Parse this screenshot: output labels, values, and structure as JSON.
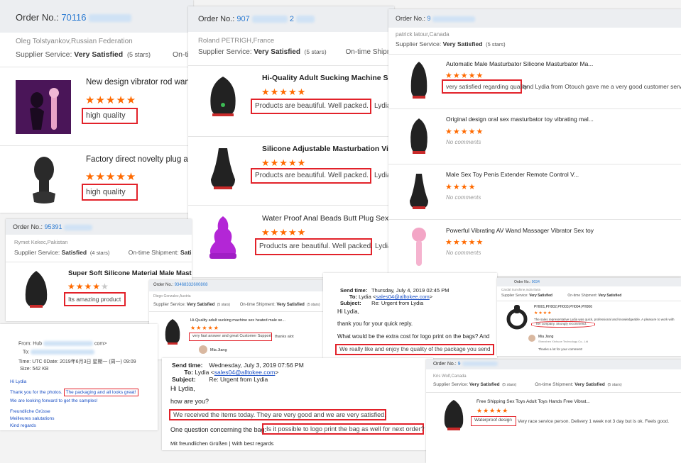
{
  "card1": {
    "order_label": "Order No.:",
    "order_no": "70116",
    "buyer": "Oleg Tolstyankov,Russian Federation",
    "supplier_label": "Supplier Service:",
    "supplier_value": "Very Satisfied",
    "supplier_stars": "(5 stars)",
    "ontime_label": "On-tim",
    "items": [
      {
        "title": "New design vibrator rod wand s",
        "stars": "★★★★★",
        "review": "high quality"
      },
      {
        "title": "Factory direct novelty plug ana",
        "stars": "★★★★★",
        "review": "high quality"
      }
    ]
  },
  "card2": {
    "order_label": "Order No.:",
    "order_no": "907",
    "order_tail": "2",
    "buyer": "Roland PETRIGH,France",
    "supplier_label": "Supplier Service:",
    "supplier_value": "Very Satisfied",
    "supplier_stars": "(5 stars)",
    "ontime_label": "On-time Shipmen",
    "items": [
      {
        "title": "Hi-Quality Adult Sucking Machine Sex He",
        "stars": "★★★★★",
        "review": "Products are beautiful. Well packed.",
        "tail": "Lydia"
      },
      {
        "title": "Silicone Adjustable Masturbation Vil",
        "stars": "★★★★★",
        "review": "Products are beautiful. Well packed.",
        "tail": "Lydia"
      },
      {
        "title": "Water Proof Anal Beads Butt Plug Sex Toy",
        "stars": "★★★★★",
        "review": "Products are beautiful. Well packed.",
        "tail": "Lydia"
      }
    ]
  },
  "card3": {
    "order_label": "Order No.:",
    "order_no": "9",
    "buyer": "patrick latour,Canada",
    "supplier_label": "Supplier Service:",
    "supplier_value": "Very Satisfied",
    "supplier_stars": "(5 stars)",
    "items": [
      {
        "title": "Automatic Male Masturbator Silicone Masturbator Ma...",
        "stars": "★★★★★",
        "review": "very satisfied regarding quality",
        "tail": "and Lydia from Otouch gave me a very good customer service"
      },
      {
        "title": "Original design oral sex masturbator toy vibrating mal...",
        "stars": "★★★★★",
        "comment": "No comments"
      },
      {
        "title": "Male Sex Toy Penis Extender Remote Control V...",
        "stars": "★★★★",
        "comment": "No comments"
      },
      {
        "title": "Powerful Vibrating AV Wand Massager Vibrator Sex toy",
        "stars": "★★★★★",
        "comment": "No comments"
      }
    ]
  },
  "card4": {
    "order_label": "Order No.:",
    "order_no": "95391",
    "buyer": "Rymet Kekec,Pakistan",
    "supplier_label": "Supplier Service:",
    "supplier_value": "Satisfied",
    "supplier_stars": "(4 stars)",
    "ontime_label": "On-time Shipment:",
    "ontime_value": "Satisfi",
    "item": {
      "title": "Super Soft Silicone Material Male Masturbator ...",
      "stars": "★★★★",
      "star_off": "★",
      "review": "Its amazing product"
    }
  },
  "card5": {
    "order_label": "Order No.:",
    "order_no": "93468332600808",
    "buyer": "Diego Gonzalez,Austria",
    "supplier_label": "Supplier Service:",
    "supplier_value": "Very Satisfied",
    "supplier_stars": "(5 stars)",
    "ontime_label": "On-time Shipment:",
    "ontime_value": "Very Satisfied",
    "ontime_stars": "(5 stars)",
    "item": {
      "title": "Hi-Quality adult sucking machine sex heated male se...",
      "stars": "★★★★★",
      "review": "very fast answer and great Customer Support",
      "tail": "thanks alot"
    },
    "reply_name": "Mia Jiang"
  },
  "card6": {
    "from_label": "From:",
    "from_value": "Hub",
    "from_tail": "com>",
    "to_label": "To:",
    "time_label": "Time:",
    "time_value": "UTC 0Date: 2019年6月3日 星期一 (周一) 09:09",
    "size_label": "Size:",
    "size_value": "542 KB",
    "greeting": "Hi Lydia",
    "line1": "Thank you for the photos.",
    "line1_hl": "The packaging and all looks great!",
    "line2": "We are looking forward to get the samples!",
    "sign1": "Freundliche Grüsse",
    "sign2": "Meilleures salutations",
    "sign3": "Kind regards"
  },
  "card7": {
    "sent_label": "Send time:",
    "sent_value": "Thursday, July 4, 2019 02:45 PM",
    "to_label": "To:",
    "to_name": "Lydia <",
    "to_email": "sales04@alltokee.com",
    "to_end": ">",
    "subj_label": "Subject:",
    "subj_value": "Re: Urgent from Lydia",
    "greeting": "Hi Lydia,",
    "line1": "thank you for your quick reply.",
    "line2": "What would be the extra cost for logo print on the bags? And",
    "line3": "We really like and enjoy the quality of the package you send"
  },
  "card8": {
    "order_label": "Order No.:",
    "order_no": "9034",
    "buyer": "Cardal Sunshine,Isola Ilaria",
    "supplier_label": "Supplier Service:",
    "supplier_value": "Very Satisfied",
    "ontime_label": "On-time Shipment:",
    "ontime_value": "Very Satisfied",
    "item_title": "PH001,PH002,PH003,PH004,PH006",
    "stars": "★★★★",
    "review1": "The sales representative Lydia was quick, professional and knowledgeable. A pleasure to work with",
    "review2": "her company. Strongly recommend.",
    "reply_name": "Mia Jiang",
    "reply_company": "Shenzhen Xinhuoe Technology Co., Ltd",
    "reply_text": "Thanks a lot for your comment!"
  },
  "card9": {
    "sent_label": "Send time:",
    "sent_value": "Wednesday, July 3, 2019 07:56 PM",
    "to_label": "To:",
    "to_name": "Lydia <",
    "to_email": "sales04@alltokee.com",
    "to_end": ">",
    "subj_label": "Subject:",
    "subj_value": "Re: Urgent from Lydia",
    "greeting": "Hi Lydia,",
    "line1": "how are you?",
    "line2": "We received the items today. They are very good and we are very satisfied.",
    "line3a": "One question concerning the bag:",
    "line3b": "Is it possible to logo print the bag as well for next order?",
    "line4": "Mit freundlichen Grüßen | With best regards"
  },
  "card10": {
    "order_label": "Order No.:",
    "order_no": "9",
    "buyer": "Kris Wolf,Canada",
    "supplier_label": "Supplier Service:",
    "supplier_value": "Very Satisfied",
    "supplier_stars": "(5 stars)",
    "ontime_label": "On-time Shipment:",
    "ontime_value": "Very Satisfied",
    "ontime_stars": "(5 stars)",
    "item_title": "Free Shipping Sex Toys Adult Toys Hands Free Vibrat...",
    "stars": "★★★★★",
    "review": "Waterproof design",
    "tail": "Very race service person. Delivery 1 week not 3 day but is ok. Feels good."
  }
}
